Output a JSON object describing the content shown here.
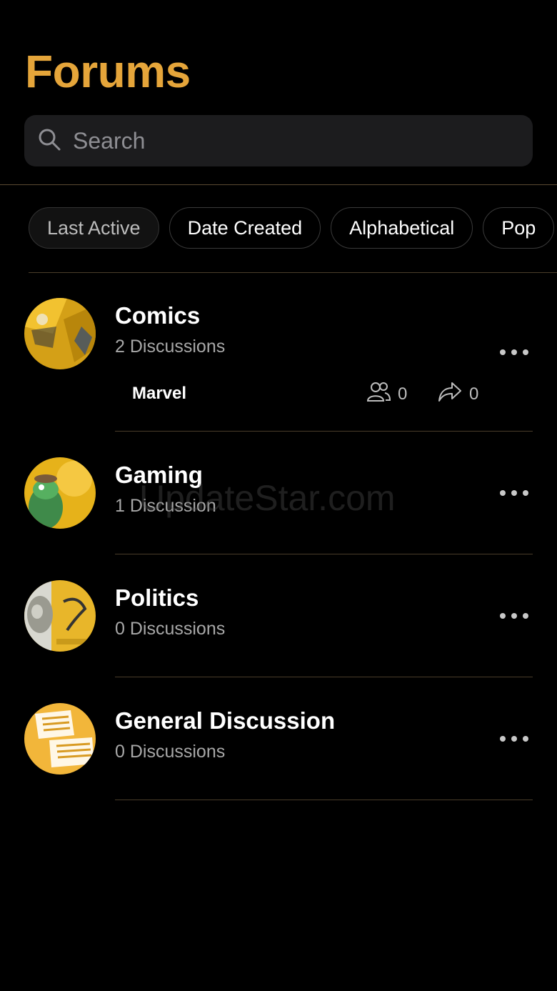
{
  "header": {
    "title": "Forums"
  },
  "search": {
    "placeholder": "Search",
    "value": ""
  },
  "sort_chips": [
    {
      "label": "Last Active"
    },
    {
      "label": "Date Created"
    },
    {
      "label": "Alphabetical"
    },
    {
      "label": "Pop"
    }
  ],
  "forums": [
    {
      "name": "Comics",
      "discussions": "2 Discussions",
      "sub_items": [
        {
          "name": "Marvel",
          "members": "0",
          "shares": "0"
        }
      ]
    },
    {
      "name": "Gaming",
      "discussions": "1 Discussion"
    },
    {
      "name": "Politics",
      "discussions": "0 Discussions"
    },
    {
      "name": "General Discussion",
      "discussions": "0 Discussions"
    }
  ],
  "watermark": "UpdateStar.com",
  "colors": {
    "accent": "#e5a53a",
    "background": "#000000",
    "surface": "#1c1c1e"
  }
}
